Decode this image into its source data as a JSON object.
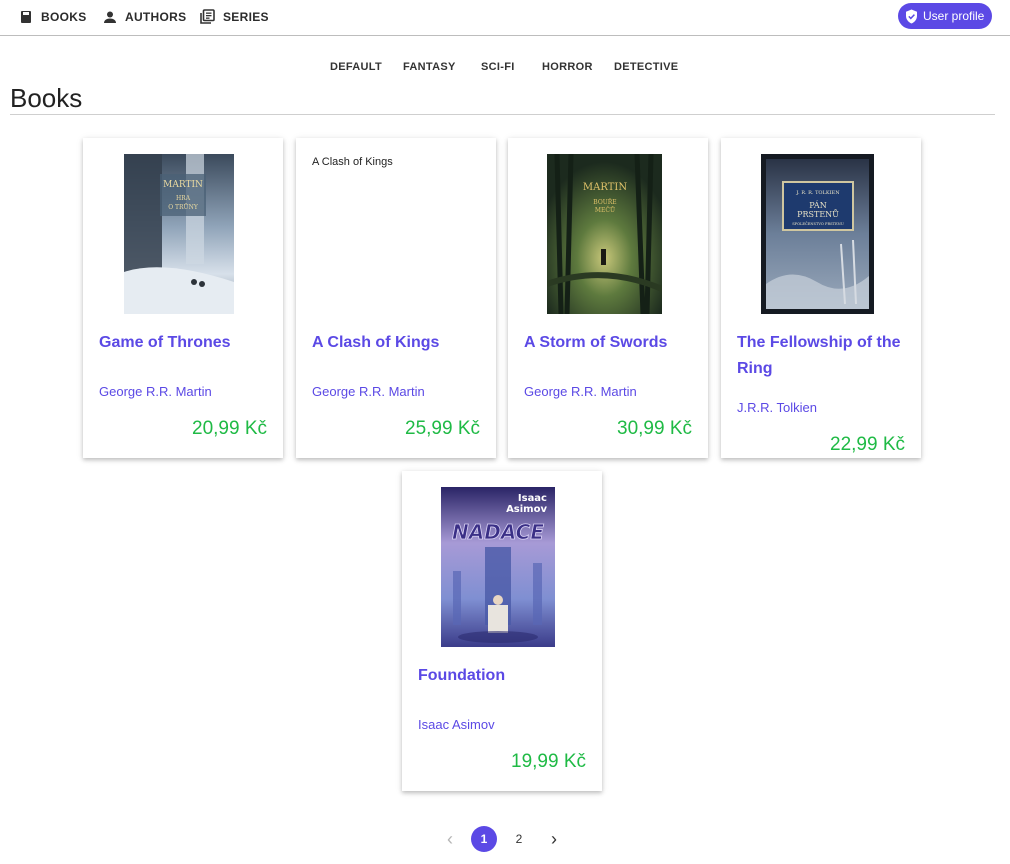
{
  "nav": {
    "books": "BOOKS",
    "authors": "AUTHORS",
    "series": "SERIES",
    "user_profile": "User profile"
  },
  "genres": [
    "DEFAULT",
    "FANTASY",
    "SCI-FI",
    "HORROR",
    "DETECTIVE"
  ],
  "page_title": "Books",
  "books": [
    {
      "title": "Game of Thrones",
      "author": "George R.R. Martin",
      "price": "20,99 Kč",
      "cover_text": "MARTIN HRA O TRŮNY"
    },
    {
      "title": "A Clash of Kings",
      "author": "George R.R. Martin",
      "price": "25,99 Kč",
      "cover_alt": "A Clash of Kings"
    },
    {
      "title": "A Storm of Swords",
      "author": "George R.R. Martin",
      "price": "30,99 Kč",
      "cover_text": "MARTIN BOUŘE MEČŮ"
    },
    {
      "title": "The Fellowship of the Ring",
      "author": "J.R.R. Tolkien",
      "price": "22,99 Kč",
      "cover_text": "J. R. R. TOLKIEN PÁN PRSTENŮ SPOLEČENSTVO PRSTENU"
    },
    {
      "title": "Foundation",
      "author": "Isaac Asimov",
      "price": "19,99 Kč",
      "cover_text": "Isaac Asimov NADACE"
    }
  ],
  "pagination": {
    "prev": "‹",
    "pages": [
      "1",
      "2"
    ],
    "next": "›",
    "current": "1"
  },
  "colors": {
    "accent": "#5b49e5",
    "price": "#1fba45"
  }
}
